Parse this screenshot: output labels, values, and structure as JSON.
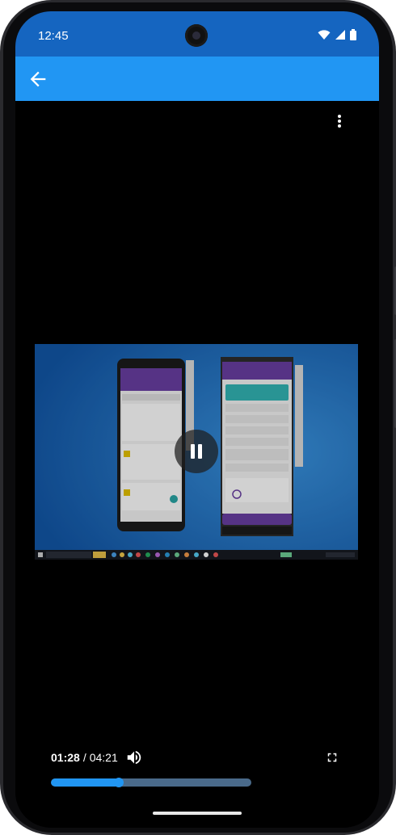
{
  "status_bar": {
    "time": "12:45",
    "icons": [
      "wifi-icon",
      "signal-icon",
      "battery-icon"
    ],
    "background": "#1565c0"
  },
  "app_bar": {
    "background": "#2196f3",
    "back_icon": "arrow-left-icon"
  },
  "overflow_menu_icon": "more-vertical-icon",
  "video": {
    "state": "playing",
    "control_icon": "pause-icon"
  },
  "player": {
    "current_time": "01:28",
    "separator": "/",
    "duration": "04:21",
    "progress_fraction": 0.337,
    "volume_icon": "volume-icon",
    "fullscreen_icon": "fullscreen-icon",
    "accent": "#2196f3"
  }
}
